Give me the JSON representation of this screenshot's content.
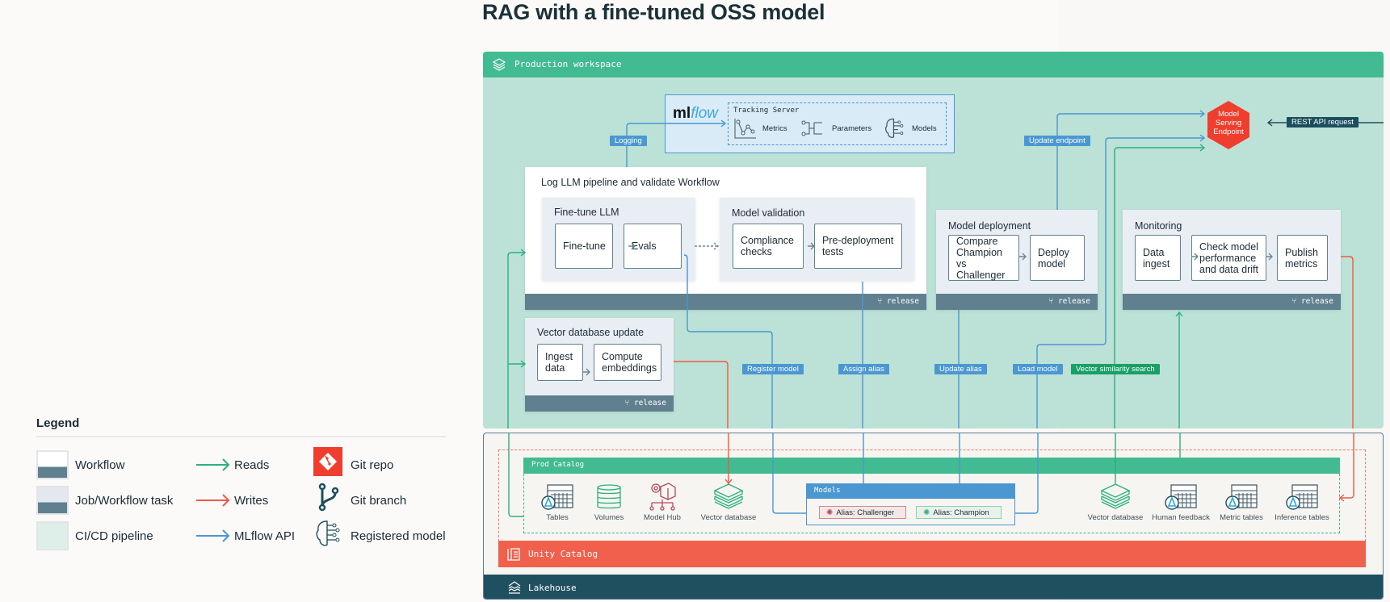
{
  "title": "RAG with a fine-tuned OSS model",
  "legend": {
    "title": "Legend",
    "items": [
      {
        "label": "Workflow",
        "icon": "workflow-swatch"
      },
      {
        "label": "Job/Workflow task",
        "icon": "task-swatch"
      },
      {
        "label": "CI/CD pipeline",
        "icon": "cicd-swatch"
      },
      {
        "label": "Reads",
        "icon": "arrow-reads",
        "color": "#2bb07e"
      },
      {
        "label": "Writes",
        "icon": "arrow-writes",
        "color": "#ef5a44"
      },
      {
        "label": "MLflow API",
        "icon": "arrow-mlflow",
        "color": "#4a97d2"
      },
      {
        "label": "Git repo",
        "icon": "git-repo-icon",
        "color": "#ef3e2d"
      },
      {
        "label": "Git branch",
        "icon": "git-branch-icon",
        "color": "#1e4f5f"
      },
      {
        "label": "Registered model",
        "icon": "registered-model-icon"
      }
    ]
  },
  "workspace": {
    "label": "Production workspace",
    "mlflow": {
      "logo_ml": "ml",
      "logo_flow": "flow",
      "tracking_server": "Tracking Server",
      "metrics": "Metrics",
      "parameters": "Parameters",
      "models": "Models"
    },
    "log_workflow": {
      "title": "Log LLM pipeline and validate Workflow",
      "finetune_task": {
        "title": "Fine-tune LLM",
        "steps": [
          "Fine-tune",
          "Evals"
        ]
      },
      "validation_task": {
        "title": "Model validation",
        "steps": [
          "Compliance checks",
          "Pre-deployment tests"
        ]
      },
      "branch": "release"
    },
    "vector_workflow": {
      "title": "Vector database update",
      "steps": [
        "Ingest data",
        "Compute embeddings"
      ],
      "branch": "release"
    },
    "deployment": {
      "title": "Model deployment",
      "steps": [
        "Compare Champion vs Challenger",
        "Deploy model"
      ],
      "branch": "release"
    },
    "monitoring": {
      "title": "Monitoring",
      "steps": [
        "Data ingest",
        "Check model performance and data drift",
        "Publish metrics"
      ],
      "branch": "release"
    },
    "serving": {
      "label": "Model Serving Endpoint"
    },
    "tags": {
      "logging": "Logging",
      "update_endpoint": "Update endpoint",
      "rest_api": "REST API request",
      "register_model": "Register model",
      "assign_alias": "Assign alias",
      "update_alias": "Update alias",
      "load_model": "Load model",
      "vector_search": "Vector similarity search"
    }
  },
  "lakehouse": {
    "label": "Lakehouse",
    "unity_catalog": "Unity Catalog",
    "prod_catalog": "Prod Catalog",
    "assets_left": [
      "Tables",
      "Volumes",
      "Model Hub",
      "Vector database"
    ],
    "models": {
      "header": "Models",
      "challenger": "Alias: Challenger",
      "champion": "Alias: Champion"
    },
    "assets_right": [
      "Vector database",
      "Human feedback",
      "Metric tables",
      "Inference tables"
    ]
  },
  "colors": {
    "reads": "#2bb07e",
    "writes": "#ef5a44",
    "mlflow_api": "#4a97d2",
    "workspace": "#42ba92",
    "unity_catalog": "#f0604c",
    "lakehouse": "#1e5060",
    "serving": "#ef3e2d"
  }
}
